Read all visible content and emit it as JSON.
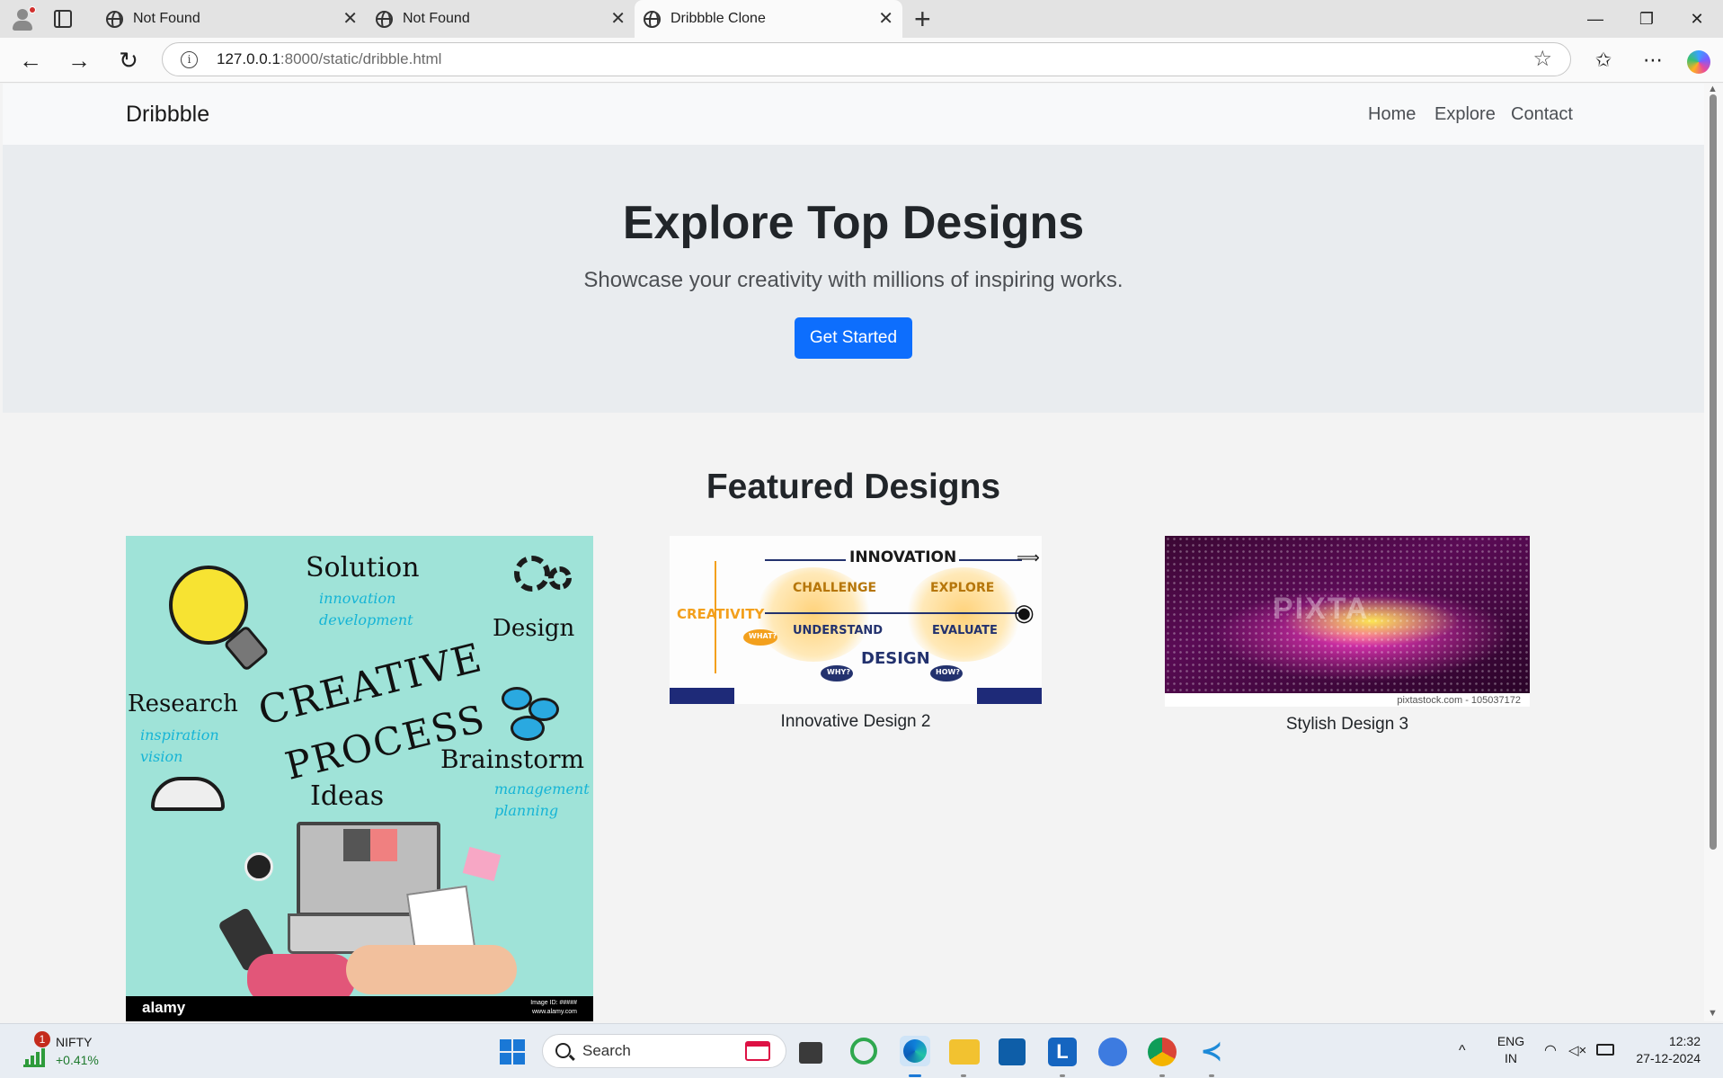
{
  "browser": {
    "tabs": [
      {
        "title": "Not Found",
        "active": false
      },
      {
        "title": "Not Found",
        "active": false
      },
      {
        "title": "Dribbble Clone",
        "active": true
      }
    ],
    "new_tab": "+",
    "window_controls": {
      "minimize": "—",
      "restore": "❐",
      "close": "✕"
    },
    "address": {
      "host": "127.0.0.1",
      "path": ":8000/static/dribble.html"
    },
    "nav": {
      "back": "←",
      "forward": "→",
      "reload": "↻"
    },
    "tools": {
      "favorites": "☆",
      "collections": "✩",
      "more": "⋯"
    }
  },
  "site": {
    "brand": "Dribbble",
    "nav_links": [
      "Home",
      "Explore",
      "Contact"
    ],
    "hero": {
      "title": "Explore Top Designs",
      "subtitle": "Showcase your creativity with millions of inspiring works.",
      "cta": "Get Started"
    },
    "featured": {
      "title": "Featured Designs",
      "cards": [
        {
          "caption": ""
        },
        {
          "caption": "Innovative Design 2"
        },
        {
          "caption": "Stylish Design 3"
        }
      ]
    }
  },
  "image1": {
    "words": {
      "solution": "Solution",
      "design": "Design",
      "research": "Research",
      "creative": "CREATIVE",
      "process": "PROCESS",
      "brainstorm": "Brainstorm",
      "ideas": "Ideas"
    },
    "sub": {
      "innovation": "innovation",
      "development": "development",
      "inspiration": "inspiration",
      "vision": "vision",
      "management": "management",
      "planning": "planning"
    },
    "footer_logo": "alamy",
    "footer_meta": [
      "Image ID: #####",
      "www.alamy.com"
    ]
  },
  "image2": {
    "innovation": "INNOVATION",
    "creativity": "CREATIVITY",
    "challenge": "CHALLENGE",
    "explore": "EXPLORE",
    "understand": "UNDERSTAND",
    "evaluate": "EVALUATE",
    "design": "DESIGN",
    "what": "WHAT?",
    "why": "WHY?",
    "how": "HOW?"
  },
  "image3": {
    "watermark": "PIXTA",
    "credit": "pixtastock.com - 105037172"
  },
  "taskbar": {
    "ticker": {
      "name": "NIFTY",
      "change": "+0.41%",
      "badge": "1"
    },
    "search_placeholder": "Search",
    "tray": {
      "lang_1": "ENG",
      "lang_2": "IN",
      "time": "12:32",
      "date": "27-12-2024",
      "expand": "^"
    }
  }
}
